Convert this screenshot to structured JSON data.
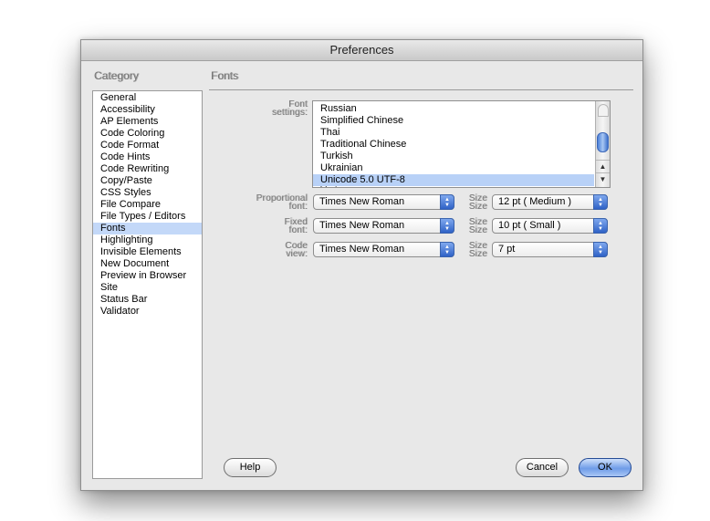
{
  "window": {
    "title": "Preferences"
  },
  "category_heading": "Category",
  "categories": [
    {
      "label": "General"
    },
    {
      "label": "Accessibility"
    },
    {
      "label": "AP Elements"
    },
    {
      "label": "Code Coloring"
    },
    {
      "label": "Code Format"
    },
    {
      "label": "Code Hints"
    },
    {
      "label": "Code Rewriting"
    },
    {
      "label": "Copy/Paste"
    },
    {
      "label": "CSS Styles"
    },
    {
      "label": "File Compare"
    },
    {
      "label": "File Types / Editors"
    },
    {
      "label": "Fonts",
      "selected": true
    },
    {
      "label": "Highlighting"
    },
    {
      "label": "Invisible Elements"
    },
    {
      "label": "New Document"
    },
    {
      "label": "Preview in Browser"
    },
    {
      "label": "Site"
    },
    {
      "label": "Status Bar"
    },
    {
      "label": "Validator"
    }
  ],
  "fonts_panel": {
    "heading": "Fonts",
    "font_settings_label": [
      "Font",
      "settings:"
    ],
    "font_settings_options": [
      "Russian",
      "Simplified Chinese",
      "Thai",
      "Traditional Chinese",
      "Turkish",
      "Ukrainian",
      "Unicode 5.0 UTF-8",
      "Vietnamese"
    ],
    "font_settings_selected": "Unicode 5.0 UTF-8",
    "proportional_label": [
      "Proportional",
      "font:"
    ],
    "proportional_font": "Times New Roman",
    "proportional_size_label": [
      "Size",
      "Size"
    ],
    "proportional_size": "12 pt  ( Medium )",
    "fixed_label": [
      "Fixed",
      "font:"
    ],
    "fixed_font": "Times New Roman",
    "fixed_size_label": [
      "Size",
      "Size"
    ],
    "fixed_size": "10 pt  ( Small )",
    "code_view_label": [
      "Code",
      "view:"
    ],
    "code_view_font": "Times New Roman",
    "code_view_size_label": [
      "Size",
      "Size"
    ],
    "code_view_size": "7 pt"
  },
  "buttons": {
    "help": "Help",
    "cancel": "Cancel",
    "ok": "OK"
  },
  "colors": {
    "selection": "#c3d8f8",
    "accent": "#3f72cc"
  },
  "icons": {
    "popup": "updown-arrows-icon",
    "scroll_up": "scroll-up-arrow-icon",
    "scroll_down": "scroll-down-arrow-icon"
  }
}
